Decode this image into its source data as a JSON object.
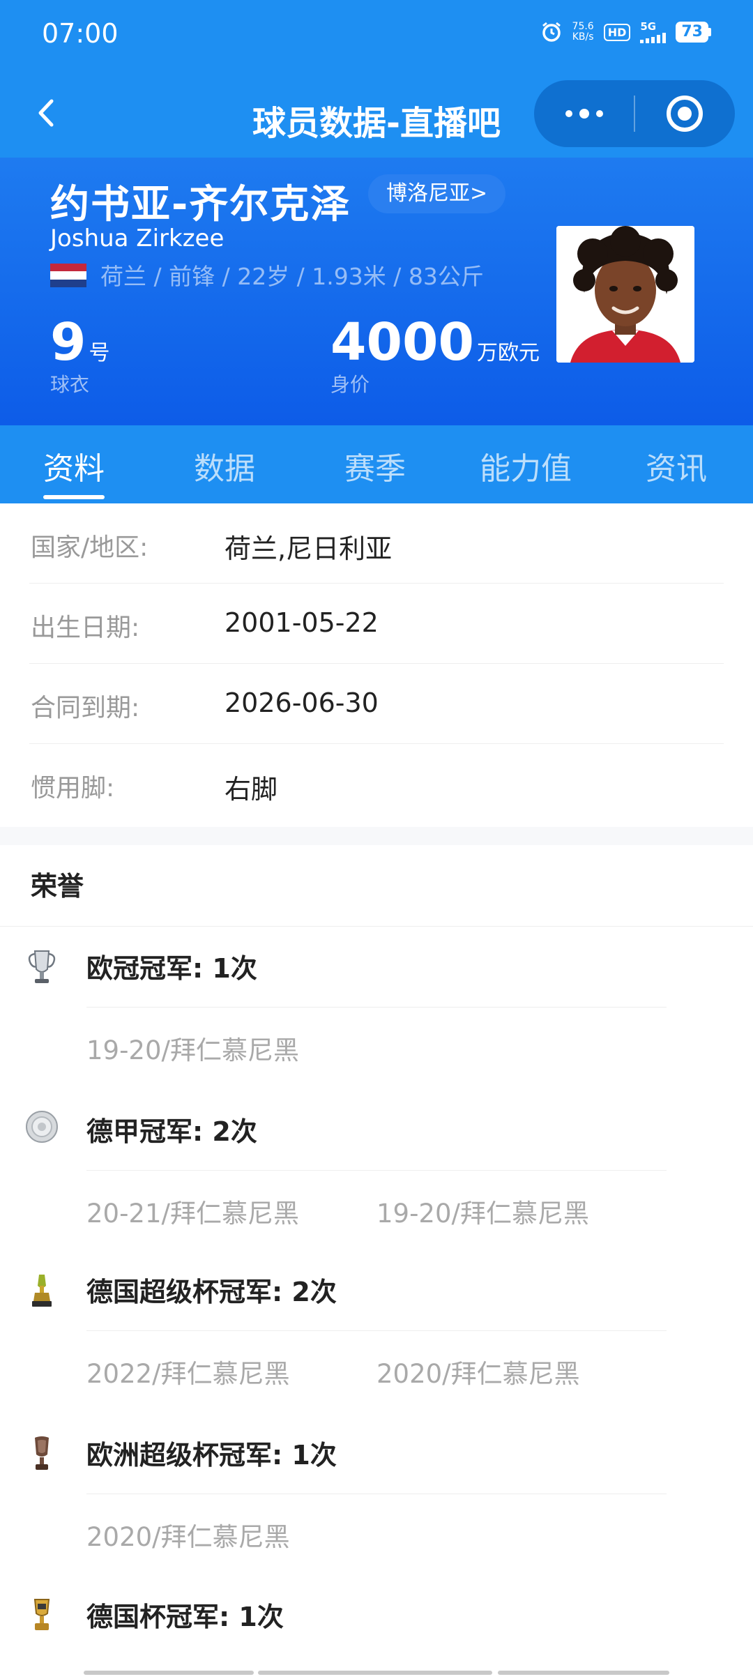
{
  "status_bar": {
    "time": "07:00",
    "net_speed_value": "75.6",
    "net_speed_unit": "KB/s",
    "hd_label": "HD",
    "network": "5G",
    "battery": "73"
  },
  "nav": {
    "title": "球员数据-直播吧"
  },
  "player": {
    "name_cn": "约书亚-齐尔克泽",
    "club": "博洛尼亚>",
    "name_en": "Joshua Zirkzee",
    "info": "荷兰 / 前锋 / 22岁 / 1.93米 / 83公斤",
    "shirt_number": "9",
    "shirt_unit": "号",
    "shirt_label": "球衣",
    "value_number": "4000",
    "value_unit": "万欧元",
    "value_label": "身价"
  },
  "tabs": [
    "资料",
    "数据",
    "赛季",
    "能力值",
    "资讯"
  ],
  "active_tab": "资料",
  "profile": [
    {
      "key": "国家/地区:",
      "value": "荷兰,尼日利亚"
    },
    {
      "key": "出生日期:",
      "value": "2001-05-22"
    },
    {
      "key": "合同到期:",
      "value": "2026-06-30"
    },
    {
      "key": "惯用脚:",
      "value": "右脚"
    }
  ],
  "honors_title": "荣誉",
  "honors": [
    {
      "title": "欧冠冠军: 1次",
      "icon": "champions-league-trophy-icon",
      "items": [
        "19-20/拜仁慕尼黑"
      ]
    },
    {
      "title": "德甲冠军: 2次",
      "icon": "bundesliga-shield-icon",
      "items": [
        "20-21/拜仁慕尼黑",
        "19-20/拜仁慕尼黑"
      ]
    },
    {
      "title": "德国超级杯冠军: 2次",
      "icon": "supercup-trophy-icon",
      "items": [
        "2022/拜仁慕尼黑",
        "2020/拜仁慕尼黑"
      ]
    },
    {
      "title": "欧洲超级杯冠军: 1次",
      "icon": "uefa-supercup-trophy-icon",
      "items": [
        "2020/拜仁慕尼黑"
      ]
    },
    {
      "title": "德国杯冠军: 1次",
      "icon": "dfb-pokal-trophy-icon",
      "items": []
    }
  ],
  "colors": {
    "primary_blue": "#1e8ff2",
    "hero_blue": "#0d5ce8",
    "muted_text": "#999999"
  }
}
